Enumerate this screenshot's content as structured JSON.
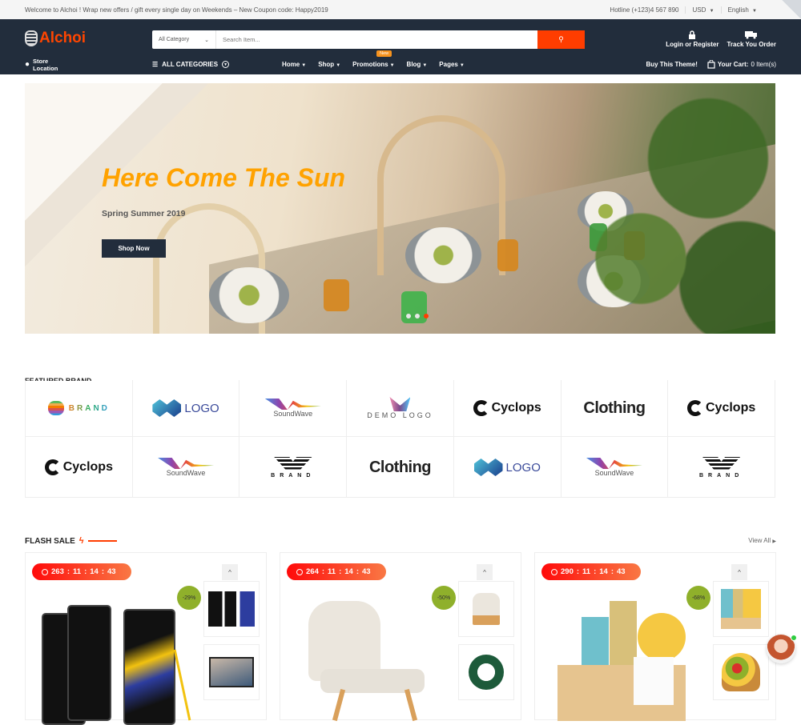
{
  "topbar": {
    "welcome": "Welcome to Alchoi ! Wrap new offers / gift every single day on Weekends – New Coupon code: Happy2019",
    "hotline": "Hotline (+123)4 567 890",
    "currency": "USD",
    "language": "English"
  },
  "header": {
    "logo": "Alchoi",
    "search": {
      "category": "All Category",
      "placeholder": "Search Item..."
    },
    "login": "Login or Register",
    "track": "Track You Order",
    "store": "Store Location",
    "all_categories": "ALL CATEGORIES",
    "menu": [
      {
        "label": "Home"
      },
      {
        "label": "Shop"
      },
      {
        "label": "Promotions",
        "badge": "New"
      },
      {
        "label": "Blog"
      },
      {
        "label": "Pages"
      }
    ],
    "buy_theme": "Buy This Theme!",
    "cart_label": "Your Cart:",
    "cart_count": "0 Item(s)"
  },
  "hero": {
    "title": "Here Come The Sun",
    "subtitle": "Spring Summer 2019",
    "cta": "Shop Now",
    "slides": 3,
    "active_slide": 3
  },
  "brands": {
    "title": "FEATURED BRAND",
    "items": [
      "BRAND",
      "LOGO",
      "SoundWave",
      "DEMO LOGO",
      "Cyclops",
      "Clothing",
      "Cyclops",
      "Cyclops",
      "SoundWave",
      "BRAND",
      "Clothing",
      "LOGO",
      "SoundWave",
      "BRAND"
    ]
  },
  "flash_sale": {
    "title": "FLASH SALE",
    "view_all": "View All",
    "cards": [
      {
        "timer": [
          "263",
          "11",
          "14",
          "43"
        ],
        "discount": "-29%",
        "product": "Samsung Galaxy phones"
      },
      {
        "timer": [
          "264",
          "11",
          "14",
          "43"
        ],
        "discount": "-50%",
        "product": "Lounge chair"
      },
      {
        "timer": [
          "290",
          "11",
          "14",
          "43"
        ],
        "discount": "-68%",
        "product": "Spa gift basket"
      }
    ]
  },
  "colors": {
    "accent": "#ff3d00",
    "nav_bg": "#222d3c",
    "hero_title": "#ffa200",
    "discount": "#8fb02b"
  }
}
